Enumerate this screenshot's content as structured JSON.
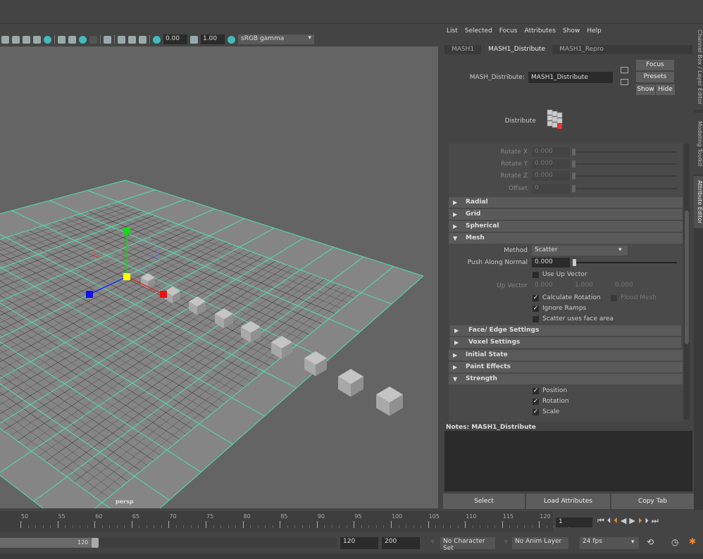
{
  "viewport_toolbar": {
    "exposure": "0.00",
    "gamma": "1.00",
    "color_space": "sRGB gamma",
    "camera_label": "persp"
  },
  "attribute_editor": {
    "menu": [
      "List",
      "Selected",
      "Focus",
      "Attributes",
      "Show",
      "Help"
    ],
    "tabs": [
      {
        "label": "MASH1",
        "active": false
      },
      {
        "label": "MASH1_Distribute",
        "active": true
      },
      {
        "label": "MASH1_Repro",
        "active": false
      }
    ],
    "node_label": "MASH_Distribute:",
    "node_name": "MASH1_Distribute",
    "buttons": {
      "focus": "Focus",
      "presets": "Presets",
      "show": "Show",
      "hide": "Hide"
    },
    "node_type": "Distribute",
    "rotate": [
      {
        "label": "Rotate X",
        "value": "0.000"
      },
      {
        "label": "Rotate Y",
        "value": "0.000"
      },
      {
        "label": "Rotate Z",
        "value": "0.000"
      },
      {
        "label": "Offset",
        "value": "0"
      }
    ],
    "sections": {
      "radial": "Radial",
      "grid": "Grid",
      "spherical": "Spherical",
      "mesh": "Mesh",
      "face_edge": "Face/ Edge Settings",
      "voxel": "Voxel Settings",
      "initial_state": "Initial State",
      "paint_effects": "Paint Effects",
      "strength": "Strength"
    },
    "mesh": {
      "method_label": "Method",
      "method_value": "Scatter",
      "push_label": "Push Along Normal",
      "push_value": "0.000",
      "use_up_vector": "Use Up Vector",
      "up_vector_label": "Up Vector",
      "up_vector": [
        "0.000",
        "1.000",
        "0.000"
      ],
      "calc_rotation": "Calculate Rotation",
      "flood_mesh": "Flood Mesh",
      "ignore_ramps": "Ignore Ramps",
      "scatter_face_area": "Scatter uses face area"
    },
    "strength": {
      "position": "Position",
      "rotation": "Rotation",
      "scale": "Scale"
    },
    "notes_label": "Notes:  MASH1_Distribute",
    "bottom_buttons": {
      "select": "Select",
      "load": "Load Attributes",
      "copy": "Copy Tab"
    }
  },
  "side_tabs": [
    "Channel Box / Layer Editor",
    "Modeling Toolkit",
    "Attribute Editor"
  ],
  "timeline": {
    "ticks": [
      "50",
      "55",
      "60",
      "65",
      "70",
      "75",
      "80",
      "85",
      "90",
      "95",
      "100",
      "105",
      "110",
      "115",
      "120"
    ],
    "current_frame": "1"
  },
  "range": {
    "range_end": "120",
    "end": "120",
    "max": "200",
    "character_set": "No Character Set",
    "anim_layer": "No Anim Layer",
    "fps": "24 fps"
  }
}
